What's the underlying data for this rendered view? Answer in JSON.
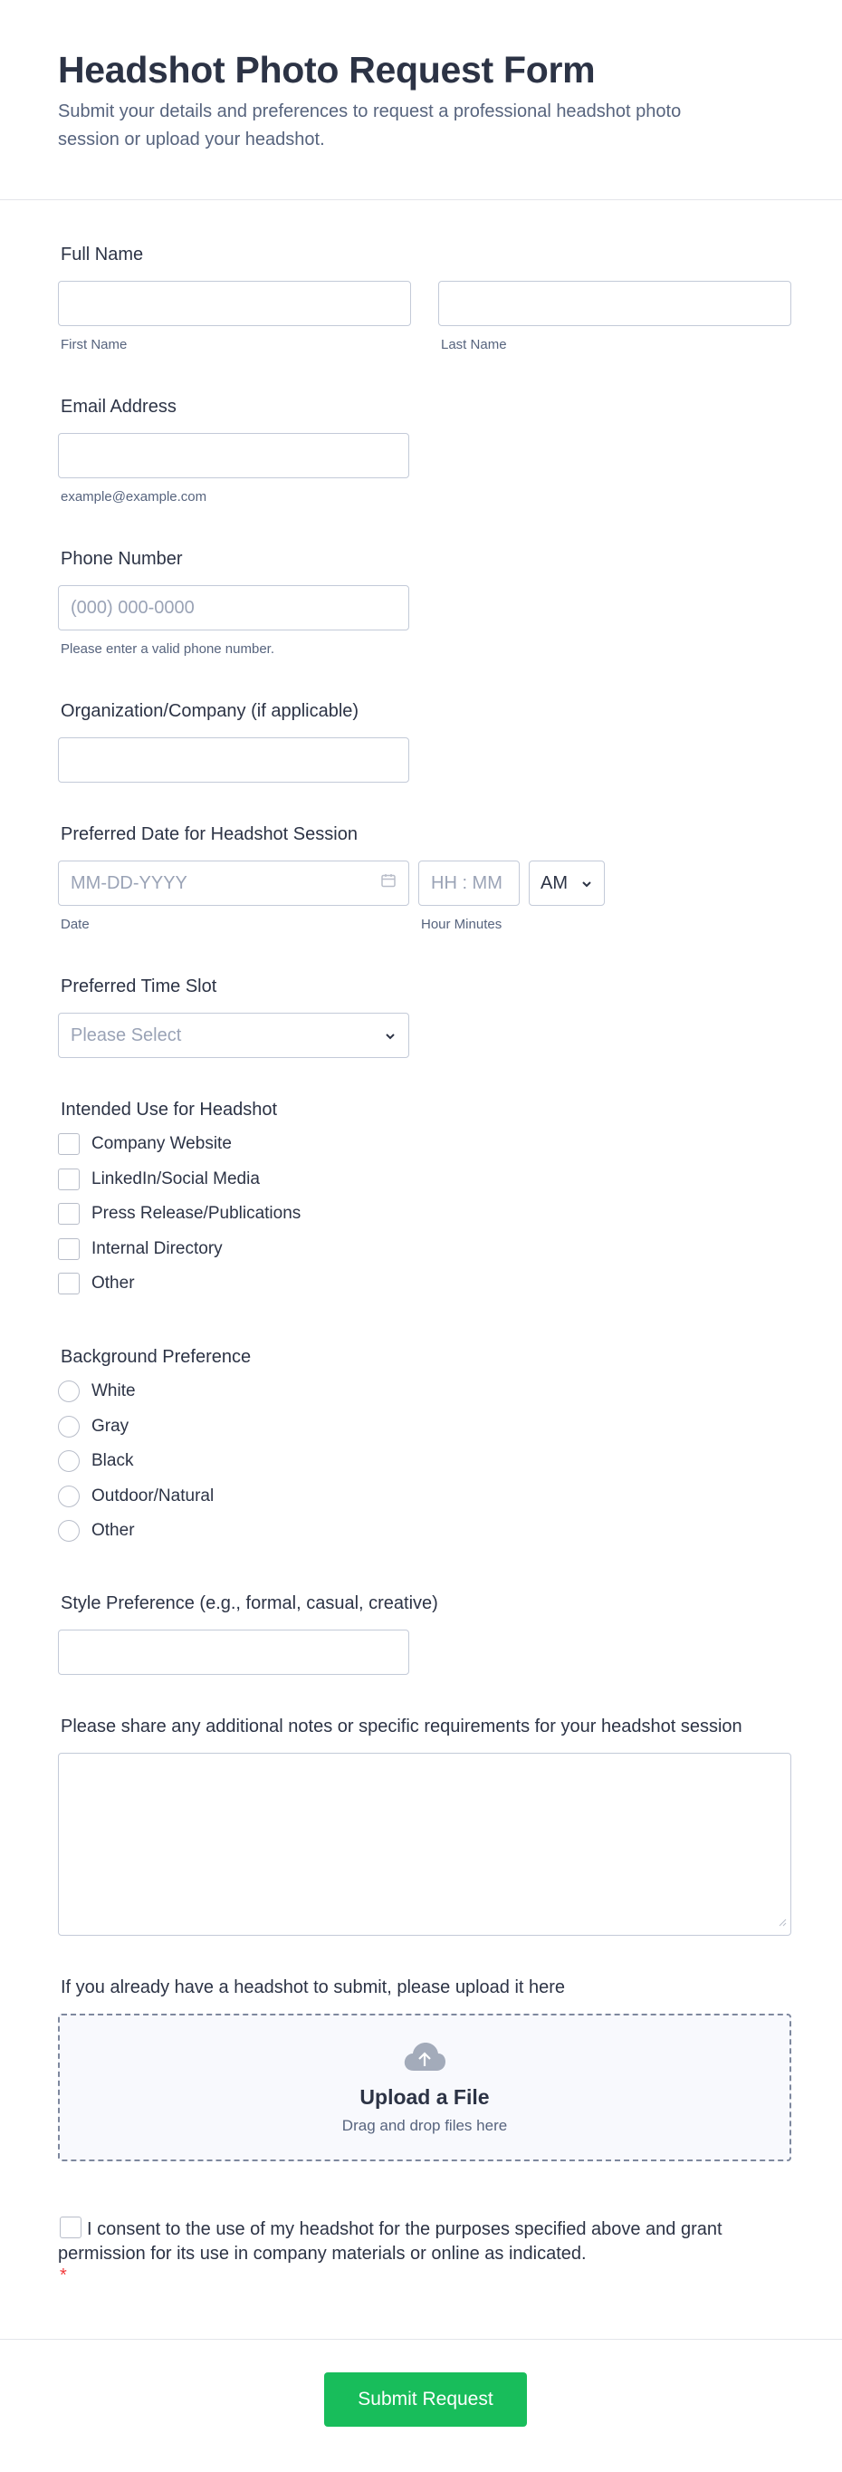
{
  "form": {
    "title": "Headshot Photo Request Form",
    "subtitle": "Submit your details and preferences to request a professional headshot photo session or upload your headshot."
  },
  "full_name": {
    "label": "Full Name",
    "first_sub": "First Name",
    "last_sub": "Last Name"
  },
  "email": {
    "label": "Email Address",
    "sub": "example@example.com"
  },
  "phone": {
    "label": "Phone Number",
    "placeholder": "(000) 000-0000",
    "sub": "Please enter a valid phone number."
  },
  "organization": {
    "label": "Organization/Company (if applicable)"
  },
  "date": {
    "label": "Preferred Date for Headshot Session",
    "date_placeholder": "MM-DD-YYYY",
    "time_placeholder": "HH : MM",
    "ampm": "AM",
    "date_sub": "Date",
    "time_sub": "Hour Minutes"
  },
  "time_slot": {
    "label": "Preferred Time Slot",
    "placeholder": "Please Select"
  },
  "intended_use": {
    "label": "Intended Use for Headshot",
    "options": [
      "Company Website",
      "LinkedIn/Social Media",
      "Press Release/Publications",
      "Internal Directory",
      "Other"
    ]
  },
  "background": {
    "label": "Background Preference",
    "options": [
      "White",
      "Gray",
      "Black",
      "Outdoor/Natural",
      "Other"
    ]
  },
  "style": {
    "label": "Style Preference (e.g., formal, casual, creative)"
  },
  "notes": {
    "label": "Please share any additional notes or specific requirements for your headshot session"
  },
  "upload": {
    "label": "If you already have a headshot to submit, please upload it here",
    "title": "Upload a File",
    "sub": "Drag and drop files here"
  },
  "consent": {
    "text": "I consent to the use of my headshot for the purposes specified above and grant permission for its use in company materials or online as indicated.",
    "required_mark": "*"
  },
  "submit": {
    "label": "Submit Request"
  },
  "colors": {
    "accent": "#18bd5b",
    "required": "#f23a3c",
    "text": "#2c3345",
    "muted": "#57647e"
  }
}
